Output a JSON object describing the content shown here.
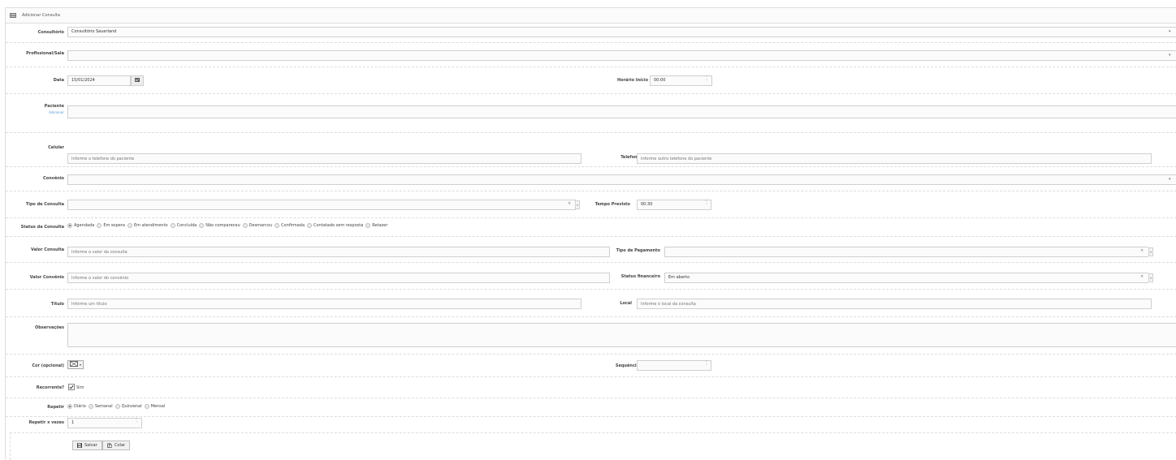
{
  "header": {
    "title": "Adicionar Consulta",
    "icon": "table-icon"
  },
  "consultorio": {
    "label": "Consultório",
    "value": "Consultório Sauerland"
  },
  "profissional": {
    "label": "Profissional/Sala",
    "value": ""
  },
  "data": {
    "label": "Data",
    "value": "15/01/2024",
    "icon": "calendar-icon"
  },
  "horario_inicio": {
    "label": "Horário Início",
    "value": "00:00"
  },
  "paciente": {
    "label": "Paciente",
    "sublabel": "Adicionar",
    "value": ""
  },
  "celular": {
    "label": "Celular",
    "placeholder": "Informe o telefone do paciente"
  },
  "telefone": {
    "label": "Telefone",
    "placeholder": "Informe outro telefone do paciente"
  },
  "convenio": {
    "label": "Convênio",
    "value": ""
  },
  "tipo_consulta": {
    "label": "Tipo de Consulta",
    "value": "",
    "clear": "×"
  },
  "tempo_previsto": {
    "label": "Tempo Previsto",
    "value": "00:30"
  },
  "status_consulta": {
    "label": "Status da Consulta",
    "options": [
      "Agendada",
      "Em espera",
      "Em atendimento",
      "Concluída",
      "Não compareceu",
      "Desmarcou",
      "Confirmada",
      "Contatado sem resposta",
      "Retazer"
    ],
    "selected": 0
  },
  "valor_consulta": {
    "label": "Valor Consulta",
    "placeholder": "Informe o valor da consulta"
  },
  "tipo_pagamento": {
    "label": "Tipo de Pagamento",
    "value": "",
    "clear": "×"
  },
  "valor_convenio": {
    "label": "Valor Convênio",
    "placeholder": "Informe o valor do convênio"
  },
  "status_financeiro": {
    "label": "Status financeiro",
    "value": "Em aberto",
    "clear": "×"
  },
  "titulo": {
    "label": "Título",
    "placeholder": "Informe um título"
  },
  "local": {
    "label": "Local",
    "placeholder": "Informe o local da consulta"
  },
  "observacoes": {
    "label": "Observações",
    "value": ""
  },
  "cor": {
    "label": "Cor (opcional)",
    "icon": "color-picker-icon"
  },
  "sequencia": {
    "label": "Sequência",
    "value": ""
  },
  "recorrente": {
    "label": "Recorrente?",
    "option": "Sim",
    "checked": true
  },
  "repetir": {
    "label": "Repetir",
    "options": [
      "Diário",
      "Semanal",
      "Quinzenal",
      "Mensal"
    ],
    "selected": 0
  },
  "repetir_vezes": {
    "label": "Repetir x vezes",
    "value": "1"
  },
  "actions": {
    "salvar": {
      "label": "Salvar",
      "icon": "save-icon"
    },
    "colar": {
      "label": "Colar",
      "icon": "paste-icon"
    }
  }
}
